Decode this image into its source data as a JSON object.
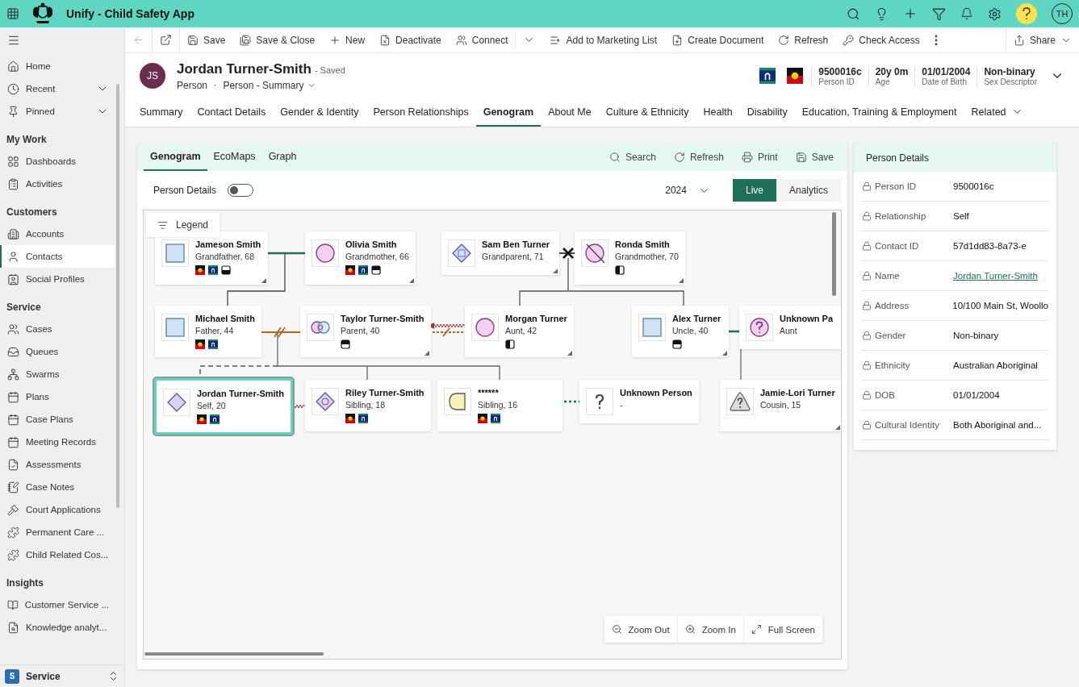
{
  "app": {
    "title": "Unify - Child Safety App",
    "user_initials": "TH"
  },
  "sidebar": {
    "groups": [
      {
        "items": [
          {
            "label": "Home",
            "expandable": false,
            "selected": false
          },
          {
            "label": "Recent",
            "expandable": true,
            "selected": false
          },
          {
            "label": "Pinned",
            "expandable": true,
            "selected": false
          }
        ]
      },
      {
        "heading": "My Work",
        "items": [
          {
            "label": "Dashboards",
            "selected": false
          },
          {
            "label": "Activities",
            "selected": false
          }
        ]
      },
      {
        "heading": "Customers",
        "items": [
          {
            "label": "Accounts",
            "selected": false
          },
          {
            "label": "Contacts",
            "selected": true
          },
          {
            "label": "Social Profiles",
            "selected": false
          }
        ]
      },
      {
        "heading": "Service",
        "items": [
          {
            "label": "Cases",
            "selected": false
          },
          {
            "label": "Queues",
            "selected": false
          },
          {
            "label": "Swarms",
            "selected": false
          },
          {
            "label": "Plans",
            "selected": false
          },
          {
            "label": "Case Plans",
            "selected": false
          },
          {
            "label": "Meeting Records",
            "selected": false
          },
          {
            "label": "Assessments",
            "selected": false
          },
          {
            "label": "Case Notes",
            "selected": false
          },
          {
            "label": "Court Applications",
            "selected": false
          },
          {
            "label": "Permanent Care ...",
            "selected": false
          },
          {
            "label": "Child Related Cos...",
            "selected": false
          }
        ]
      },
      {
        "heading": "Insights",
        "items": [
          {
            "label": "Customer Service ...",
            "selected": false
          },
          {
            "label": "Knowledge analyt...",
            "selected": false
          }
        ]
      }
    ],
    "area": {
      "initial": "S",
      "label": "Service"
    }
  },
  "commands": [
    "Save",
    "Save & Close",
    "New",
    "Deactivate",
    "Connect",
    "Add to Marketing List",
    "Create Document",
    "Refresh",
    "Check Access"
  ],
  "share": "Share",
  "record": {
    "initials": "JS",
    "name": "Jordan Turner-Smith",
    "status": "- Saved",
    "entity": "Person",
    "separator": "·",
    "form": "Person - Summary",
    "facts": [
      {
        "value": "9500016c",
        "label": "Person ID"
      },
      {
        "value": "20y 0m",
        "label": "Age"
      },
      {
        "value": "01/01/2004",
        "label": "Date of Birth"
      },
      {
        "value": "Non-binary",
        "label": "Sex Descriptor"
      }
    ]
  },
  "tabs": [
    {
      "label": "Summary",
      "selected": false
    },
    {
      "label": "Contact Details",
      "selected": false
    },
    {
      "label": "Gender & Identity",
      "selected": false
    },
    {
      "label": "Person Relationships",
      "selected": false
    },
    {
      "label": "Genogram",
      "selected": true
    },
    {
      "label": "About Me",
      "selected": false
    },
    {
      "label": "Culture & Ethnicity",
      "selected": false
    },
    {
      "label": "Health",
      "selected": false
    },
    {
      "label": "Disability",
      "selected": false
    },
    {
      "label": "Education, Training & Employment",
      "selected": false
    },
    {
      "label": "Related",
      "selected": false
    }
  ],
  "genogram": {
    "tabs": [
      {
        "label": "Genogram",
        "selected": true
      },
      {
        "label": "EcoMaps",
        "selected": false
      },
      {
        "label": "Graph",
        "selected": false
      }
    ],
    "actions": [
      "Search",
      "Refresh",
      "Print",
      "Save"
    ],
    "toggle": {
      "label": "Person Details",
      "on": false
    },
    "year": "2024",
    "modes": [
      {
        "label": "Live",
        "selected": true
      },
      {
        "label": "Analytics",
        "selected": false
      }
    ],
    "legend": "Legend",
    "nodes": [
      {
        "name": "Jameson Smith",
        "role": "Grandfather, 68",
        "kind": "square",
        "badges": [
          {
            "kind": "aboriginal"
          },
          {
            "kind": "torres"
          },
          {
            "kind": "half-bottom"
          }
        ],
        "selected": false,
        "expandable": true
      },
      {
        "name": "Olivia Smith",
        "role": "Grandmother, 66",
        "kind": "circle",
        "badges": [
          {
            "kind": "aboriginal"
          },
          {
            "kind": "torres"
          },
          {
            "kind": "half-top"
          }
        ],
        "selected": false,
        "expandable": true
      },
      {
        "name": "Sam Ben Turner",
        "role": "Grandparent, 71",
        "kind": "diamond-square",
        "selected": false,
        "expandable": true
      },
      {
        "name": "Ronda Smith",
        "role": "Grandmother, 70",
        "kind": "crossed-circle",
        "badges": [
          {
            "kind": "half-left"
          }
        ],
        "selected": false,
        "expandable": true
      },
      {
        "name": "Michael Smith",
        "role": "Father, 44",
        "kind": "square",
        "badges": [
          {
            "kind": "aboriginal"
          },
          {
            "kind": "torres"
          }
        ],
        "selected": false,
        "expandable": false
      },
      {
        "name": "Taylor Turner-Smith",
        "role": "Parent, 40",
        "kind": "rings",
        "badges": [
          {
            "kind": "half-top"
          }
        ],
        "selected": false,
        "expandable": true
      },
      {
        "name": "Morgan Turner",
        "role": "Aunt, 42",
        "kind": "circle",
        "badges": [
          {
            "kind": "half-left"
          }
        ],
        "selected": false,
        "expandable": true
      },
      {
        "name": "Alex Turner",
        "role": "Uncle, 40",
        "kind": "square",
        "badges": [
          {
            "kind": "half-top"
          }
        ],
        "selected": false,
        "expandable": true
      },
      {
        "name": "Unknown Pa",
        "role": "Aunt",
        "kind": "circle-question",
        "selected": false,
        "expandable": false
      },
      {
        "name": "Jordan Turner-Smith",
        "role": "Self, 20",
        "kind": "diamond",
        "badges": [
          {
            "kind": "aboriginal"
          },
          {
            "kind": "torres"
          }
        ],
        "selected": true,
        "expandable": false
      },
      {
        "name": "Riley Turner-Smith",
        "role": "Sibling, 18",
        "kind": "diamond-circle",
        "badges": [
          {
            "kind": "aboriginal"
          },
          {
            "kind": "torres"
          }
        ],
        "selected": false,
        "expandable": false
      },
      {
        "name": "******",
        "role": "Sibling, 16",
        "kind": "half-round",
        "badges": [
          {
            "kind": "aboriginal"
          },
          {
            "kind": "torres"
          }
        ],
        "selected": false,
        "expandable": false
      },
      {
        "name": "Unknown Person",
        "role": "-",
        "kind": "question",
        "selected": false,
        "expandable": false
      },
      {
        "name": "Jamie-Lori Turner",
        "role": "Cousin, 15",
        "kind": "triangle-question",
        "selected": false,
        "expandable": true
      }
    ],
    "zoom": [
      "Zoom Out",
      "Zoom In",
      "Full Screen"
    ]
  },
  "person_details": {
    "title": "Person Details",
    "rows": [
      {
        "label": "Person ID",
        "value": "9500016c",
        "kind": "text"
      },
      {
        "label": "Relationship",
        "value": "Self",
        "kind": "text"
      },
      {
        "label": "Contact ID",
        "value": "57d1dd83-8a73-e",
        "kind": "text"
      },
      {
        "label": "Name",
        "value": "Jordan Turner-Smith",
        "kind": "link"
      },
      {
        "label": "Address",
        "value": "10/100 Main St, Woollo",
        "kind": "text"
      },
      {
        "label": "Gender",
        "value": "Non-binary",
        "kind": "text"
      },
      {
        "label": "Ethnicity",
        "value": "Australian Aboriginal",
        "kind": "text"
      },
      {
        "label": "DOB",
        "value": "01/01/2004",
        "kind": "text"
      },
      {
        "label": "Cultural Identity",
        "value": "Both Aboriginal and...",
        "kind": "text"
      }
    ]
  }
}
